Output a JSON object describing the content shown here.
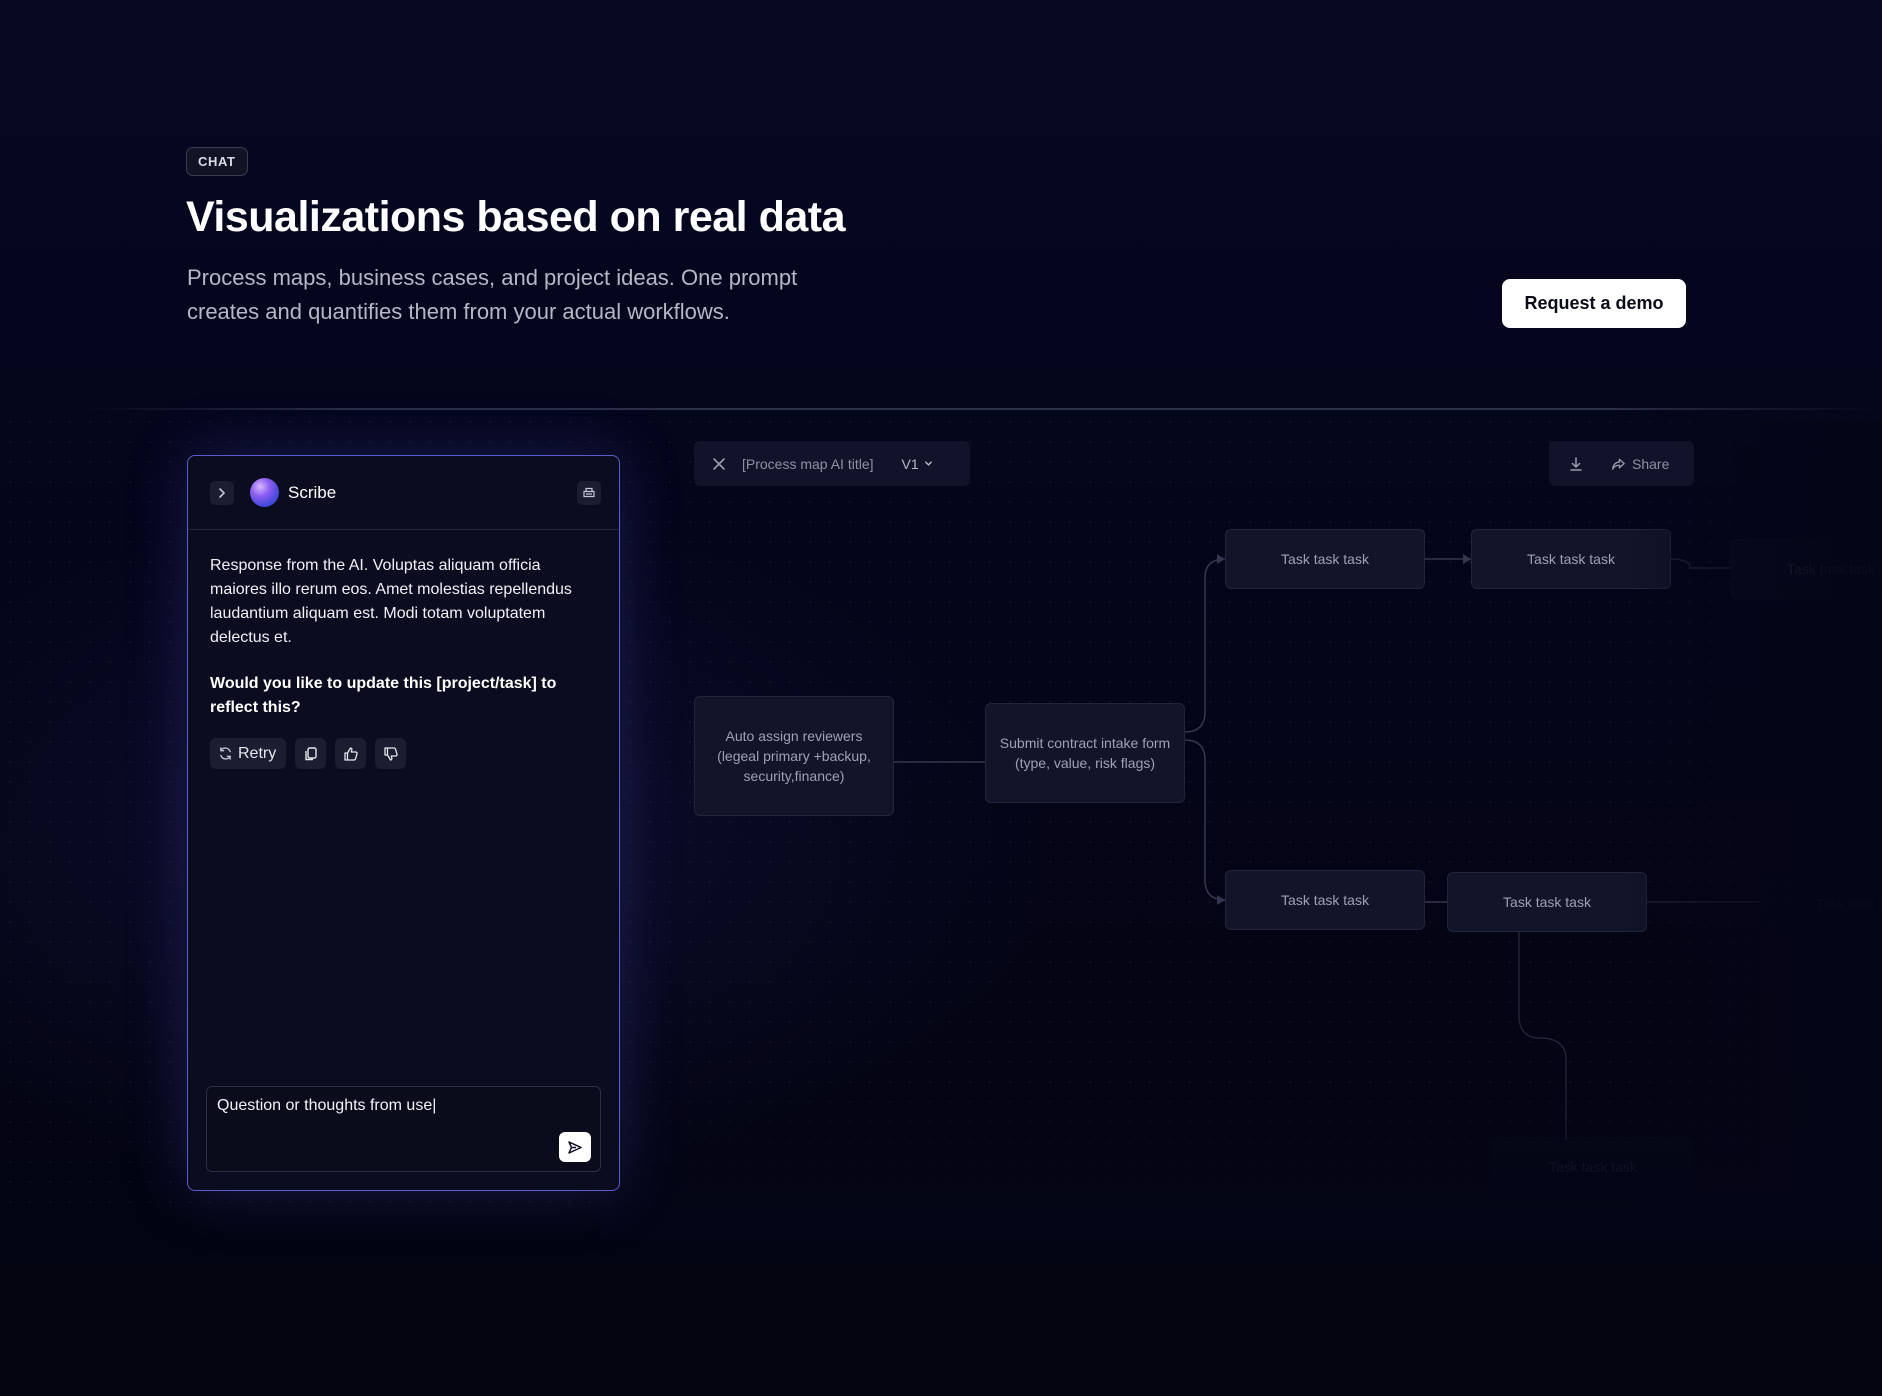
{
  "hero": {
    "badge": "CHAT",
    "title": "Visualizations based on real data",
    "subtitle_line1": "Process maps, business cases, and project ideas. One prompt",
    "subtitle_line2": "creates and quantifies them from your actual workflows.",
    "cta_label": "Request a demo"
  },
  "chat": {
    "assistant_name": "Scribe",
    "ai_response": "Response from the AI. Voluptas aliquam officia maiores illo rerum eos. Amet molestias repellendus laudantium aliquam est. Modi totam voluptatem delectus et.",
    "ai_question": "Would you like to update this [project/task] to reflect this?",
    "retry_label": "Retry",
    "composer_value": "Question or thoughts from use|",
    "icons": [
      "chevron-right-icon",
      "printer-icon",
      "refresh-icon",
      "copy-icon",
      "thumbs-up-icon",
      "thumbs-down-icon",
      "send-icon"
    ],
    "accent_color": "#5b5ccd"
  },
  "process_map": {
    "title": "[Process map AI title]",
    "version": "V1",
    "share_label": "Share",
    "icons": [
      "close-icon",
      "chevron-down-icon",
      "download-icon",
      "share-icon"
    ],
    "nodes": {
      "auto_assign": "Auto assign reviewers (legeal primary +backup, security,finance)",
      "submit_contract": "Submit contract intake form (type, value, risk flags)",
      "task_1": "Task task task",
      "task_2": "Task task task",
      "task_3": "Task task task",
      "task_4": "Task task task",
      "task_5": "Task task task",
      "task_6": "Task task task",
      "task_7": "Task task task"
    }
  }
}
